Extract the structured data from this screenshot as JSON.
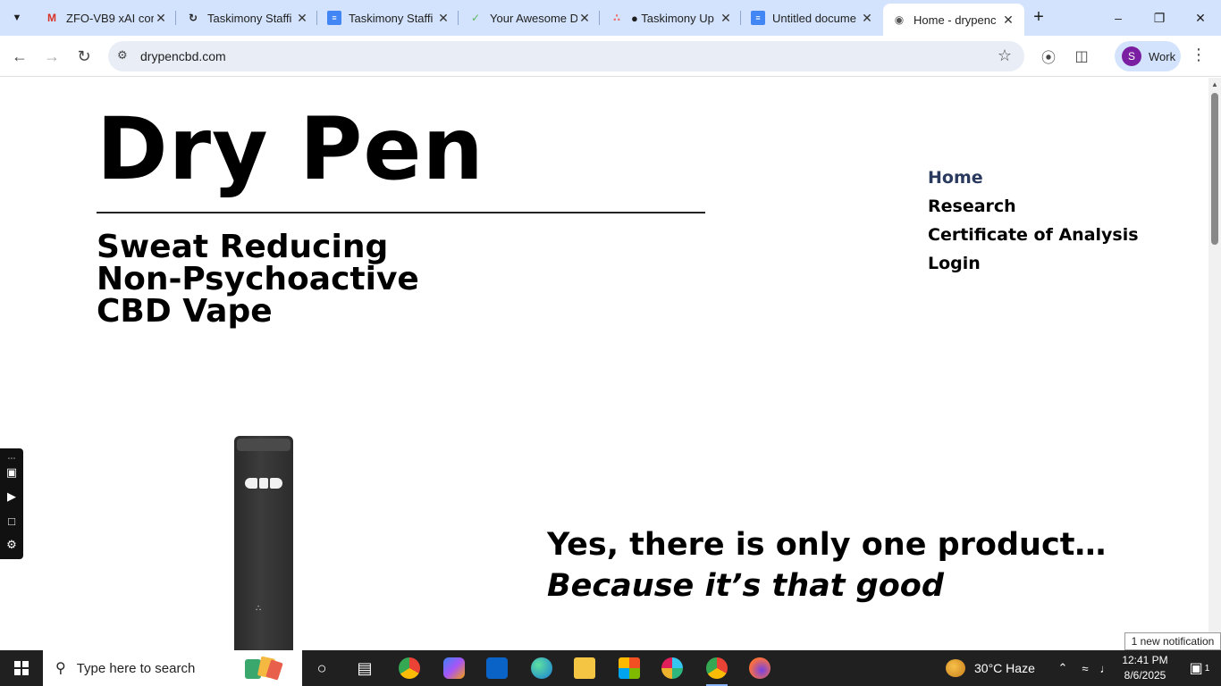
{
  "browser": {
    "tabs": [
      {
        "title": "ZFO-VB9 xAI cor",
        "icon": "gmail-icon"
      },
      {
        "title": "Taskimony Staffi",
        "icon": "loop-icon"
      },
      {
        "title": "Taskimony Staffi",
        "icon": "docs-icon"
      },
      {
        "title": "Your Awesome D",
        "icon": "check-icon"
      },
      {
        "title": "● Taskimony Up",
        "icon": "asana-icon"
      },
      {
        "title": "Untitled docume",
        "icon": "docs-icon"
      },
      {
        "title": "Home - drypenc",
        "icon": "globe-icon",
        "active": true
      }
    ],
    "url": "drypencbd.com",
    "profile_label": "Work",
    "profile_initial": "S"
  },
  "site": {
    "logo": "Dry Pen",
    "tagline": [
      "Sweat Reducing",
      "Non-Psychoactive",
      "CBD Vape"
    ],
    "nav": [
      {
        "label": "Home",
        "current": true
      },
      {
        "label": "Research"
      },
      {
        "label": "Certificate of Analysis"
      },
      {
        "label": "Login"
      }
    ],
    "headline_line1": "Yes, there is only one product…",
    "headline_line2": "Because it’s that good"
  },
  "taskbar": {
    "search_placeholder": "Type here to search",
    "weather": "30°C  Haze",
    "time": "12:41 PM",
    "date": "8/6/2025",
    "notification": "1 new notification",
    "notification_count": "1"
  },
  "colors": {
    "tabstrip_bg": "#d3e3fd",
    "nav_current": "#2a3a5e",
    "taskbar_bg": "#202020"
  }
}
